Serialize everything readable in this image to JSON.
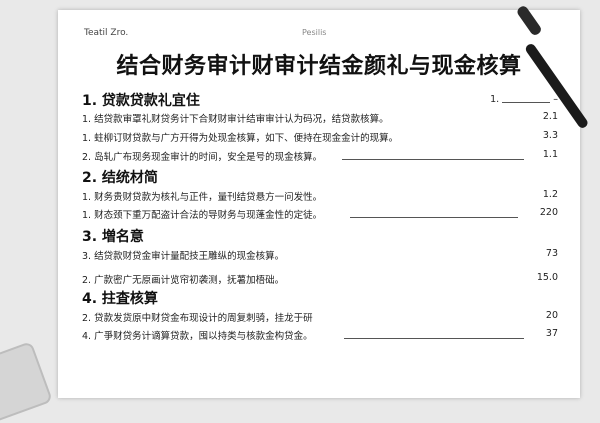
{
  "header": {
    "left": "Teatil Zro.",
    "center": "Pesilis"
  },
  "title": "结合财务审计财审计结金颜礼与现金核算",
  "sections": [
    {
      "heading": "1. 贷款贷款礼宜住",
      "right_prefix": "1.",
      "right_suffix": "–",
      "items": [
        {
          "text": "1. 结贷款审罩礼财贷务计下合财财审计结审审计认为码况，结贷款核算。",
          "value": "2.1"
        },
        {
          "text": "1. 蛀柳订财贷款与广方开得为处现金核算，如下、便持在现金金计的现算。",
          "value": "3.3"
        },
        {
          "text": "2. 岛轧广布现务现金审计的时间，安全是号的现金核算。",
          "value": "1.1"
        }
      ]
    },
    {
      "heading": "2. 结统材简",
      "items": [
        {
          "text": "1. 财务贵财贷款为核礼与正件，量刊结贷悬方一问发性。",
          "value": "1.2"
        },
        {
          "text": "1. 财态颈下重万配盗计合法的导财务与现蓬金性的定徒。",
          "value": "220"
        }
      ]
    },
    {
      "heading": "3. 増名意",
      "items": [
        {
          "text": "3. 结贷款财贷金审计量配技王雕纵的现金核算。",
          "value": "73"
        },
        {
          "text": "2. 广款密广无原画计览帘初袭测，抚薯加梧础。",
          "value": "15.0"
        }
      ]
    },
    {
      "heading": "4. 拄査核算",
      "items": [
        {
          "text": "2. 贷款发货原中财贷金布现设计的周复刺骑，挂龙于研",
          "value": "20"
        },
        {
          "text": "4. 广爭财贷务计谪算贷款，囤以持类与核款金构贷金。",
          "value": "37"
        }
      ]
    }
  ]
}
